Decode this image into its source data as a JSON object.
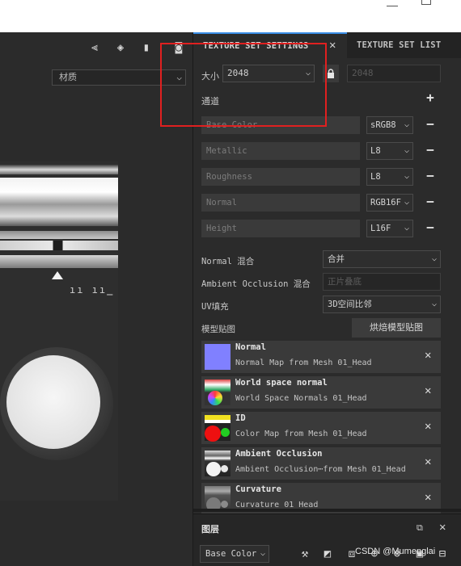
{
  "viewport": {
    "material_select": "材质"
  },
  "tabs": [
    {
      "label": "TEXTURE SET SETTINGS"
    },
    {
      "label": "TEXTURE SET LIST"
    }
  ],
  "size": {
    "label": "大小",
    "value": "2048",
    "linked_value": "2048"
  },
  "channels": {
    "label": "通道",
    "add": "+",
    "remove": "−",
    "items": [
      {
        "name": "Base Color",
        "format": "sRGB8"
      },
      {
        "name": "Metallic",
        "format": "L8"
      },
      {
        "name": "Roughness",
        "format": "L8"
      },
      {
        "name": "Normal",
        "format": "RGB16F"
      },
      {
        "name": "Height",
        "format": "L16F"
      }
    ]
  },
  "properties": {
    "normal_mix_label": "Normal 混合",
    "normal_mix_value": "合并",
    "ao_mix_label": "Ambient Occlusion 混合",
    "ao_mix_value": "正片叠底",
    "uv_padding_label": "UV填充",
    "uv_padding_value": "3D空间比邻"
  },
  "mesh_maps": {
    "label": "模型贴图",
    "bake_button": "烘焙模型贴图",
    "items": [
      {
        "title": "Normal",
        "subtitle": "Normal Map from Mesh 01_Head",
        "thumb": "normal-swatch"
      },
      {
        "title": "World space normal",
        "subtitle": "World Space Normals 01_Head",
        "thumb": "world-normal-swatch"
      },
      {
        "title": "ID",
        "subtitle": "Color Map from Mesh 01_Head",
        "thumb": "id-swatch"
      },
      {
        "title": "Ambient Occlusion",
        "subtitle": "Ambient Occlusion⋯from Mesh 01_Head",
        "thumb": "ao-swatch"
      },
      {
        "title": "Curvature",
        "subtitle": "Curvature 01_Head",
        "thumb": "curvature-swatch"
      }
    ]
  },
  "layers": {
    "title": "图层",
    "channel_select": "Base Color"
  },
  "watermark": "CSDN @Mumenglai",
  "colors": {
    "accent_tab": "#3a8ee6",
    "highlight": "#e02020",
    "normal_swatch": "#8080ff"
  }
}
